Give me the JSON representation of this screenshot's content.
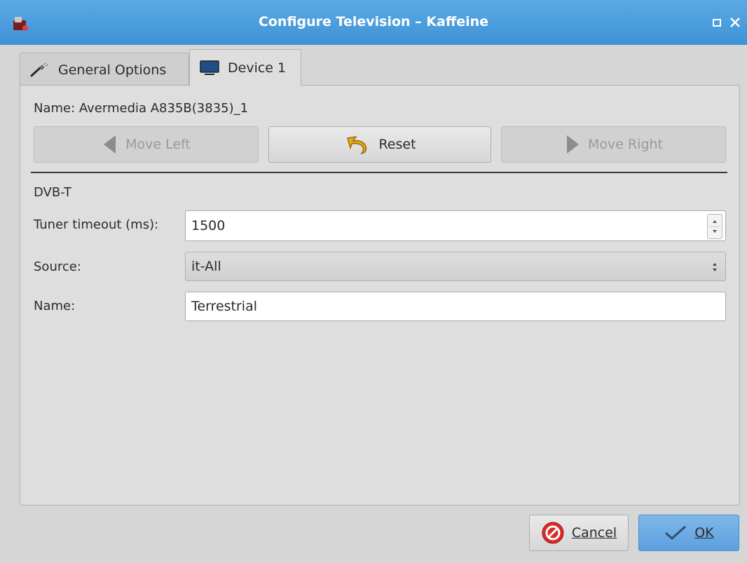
{
  "window": {
    "title": "Configure Television – Kaffeine"
  },
  "tabs": [
    {
      "label": "General Options",
      "icon": "wrench-icon",
      "active": false
    },
    {
      "label": "Device 1",
      "icon": "monitor-icon",
      "active": true
    }
  ],
  "device": {
    "name_text": "Name: Avermedia A835B(3835)_1"
  },
  "device_buttons": {
    "move_left": "Move Left",
    "reset": "Reset",
    "move_right": "Move Right"
  },
  "section": {
    "title": "DVB-T"
  },
  "form": {
    "tuner_timeout_label": "Tuner timeout (ms):",
    "tuner_timeout_value": "1500",
    "source_label": "Source:",
    "source_value": "it-All",
    "name_label": "Name:",
    "name_value": "Terrestrial"
  },
  "dialog_buttons": {
    "cancel": "Cancel",
    "ok": "OK"
  },
  "colors": {
    "titlebar": "#4a9ddf",
    "ok_button": "#6aa9e5",
    "cancel_icon": "#d92b2b",
    "reset_icon": "#e7a81a"
  }
}
